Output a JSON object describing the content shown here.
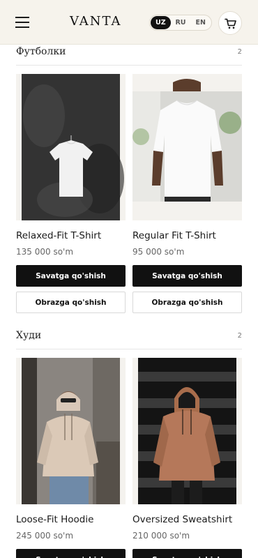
{
  "header": {
    "menu_icon": "hamburger-menu-icon",
    "logo": "VANTA",
    "languages": [
      "UZ",
      "RU",
      "EN"
    ],
    "active_language": "UZ",
    "cart_icon": "shopping-cart-icon"
  },
  "sections": [
    {
      "title": "Футболки",
      "count": "2",
      "products": [
        {
          "name": "Relaxed-Fit T-Shirt",
          "price": "135 000 so'm",
          "add_to_cart": "Savatga qo'shish",
          "try_on": "Obrazga qo'shish"
        },
        {
          "name": "Regular Fit T-Shirt",
          "price": "95 000 so'm",
          "add_to_cart": "Savatga qo'shish",
          "try_on": "Obrazga qo'shish"
        }
      ]
    },
    {
      "title": "Худи",
      "count": "2",
      "products": [
        {
          "name": "Loose-Fit Hoodie",
          "price": "245 000 so'm",
          "add_to_cart": "Savatga qo'shish"
        },
        {
          "name": "Oversized Sweatshirt",
          "price": "210 000 so'm",
          "add_to_cart": "Savatga qo'shish"
        }
      ]
    }
  ],
  "colors": {
    "header_bg": "#f6f3ec",
    "primary": "#111111",
    "accent_text": "#ffffff"
  }
}
